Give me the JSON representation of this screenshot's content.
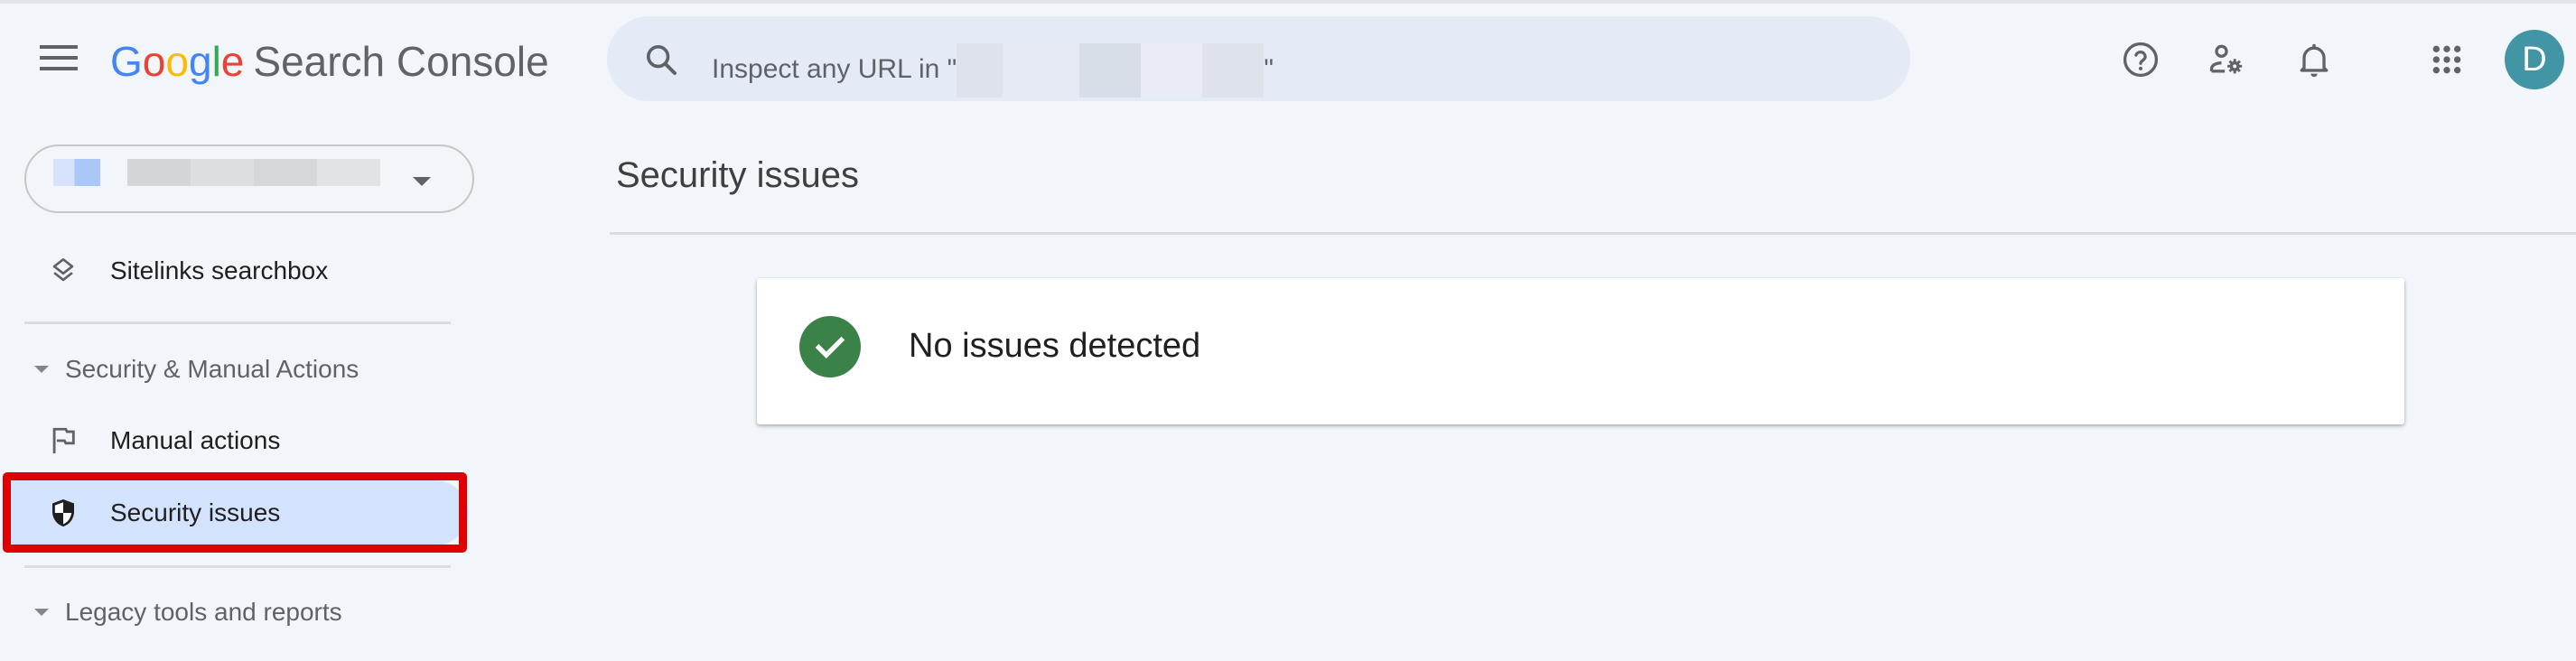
{
  "header": {
    "menu_icon": "hamburger-menu-icon",
    "logo": {
      "brand_letters": [
        "G",
        "o",
        "o",
        "g",
        "l",
        "e"
      ],
      "product": "Search Console"
    },
    "search": {
      "placeholder_prefix": "Inspect any URL in \"",
      "placeholder_suffix": "\"",
      "icon": "search-icon"
    },
    "actions": [
      {
        "name": "help",
        "icon": "help-circle-icon"
      },
      {
        "name": "users-and-permissions",
        "icon": "manage-accounts-icon"
      },
      {
        "name": "notifications",
        "icon": "bell-icon"
      },
      {
        "name": "google-apps",
        "icon": "apps-grid-icon"
      }
    ],
    "avatar": {
      "initial": "D",
      "color": "#4295A5"
    }
  },
  "sidebar": {
    "property_selector": {
      "icon": "dropdown-caret-icon"
    },
    "items": [
      {
        "label": "Sitelinks searchbox",
        "icon": "layers-icon",
        "selected": false
      }
    ],
    "sections": [
      {
        "label": "Security & Manual Actions",
        "expanded": true,
        "items": [
          {
            "label": "Manual actions",
            "icon": "flag-icon",
            "selected": false
          },
          {
            "label": "Security issues",
            "icon": "shield-icon",
            "selected": true
          }
        ]
      },
      {
        "label": "Legacy tools and reports",
        "expanded": true,
        "items": []
      }
    ]
  },
  "main": {
    "title": "Security issues",
    "status_card": {
      "icon": "check-circle-icon",
      "message": "No issues detected",
      "status_color": "#3B8249"
    }
  },
  "annotation": {
    "highlight_color": "#E00000",
    "target": "Security issues"
  },
  "colors": {
    "background": "#F2F5FA",
    "search_bg": "#E4EBF7",
    "selected_bg": "#D3E3FD"
  }
}
